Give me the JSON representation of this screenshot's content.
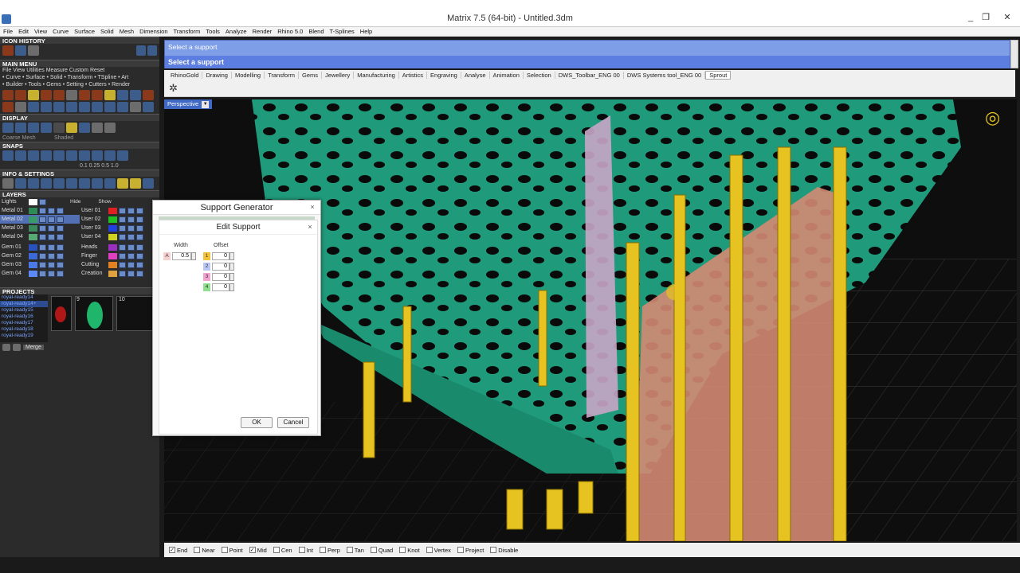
{
  "window": {
    "title": "Matrix 7.5 (64-bit) - Untitled.3dm",
    "minimize": "_",
    "maximize": "❐",
    "close": "✕"
  },
  "menu": [
    "File",
    "Edit",
    "View",
    "Curve",
    "Surface",
    "Solid",
    "Mesh",
    "Dimension",
    "Transform",
    "Tools",
    "Analyze",
    "Render",
    "Rhino 5.0",
    "Blend",
    "T-Splines",
    "Help"
  ],
  "left": {
    "icon_history": "ICON HISTORY",
    "main_menu": "MAIN MENU",
    "main_menu_row1": "File   View   Utilities   Measure   Custom            Reset",
    "main_menu_row2": "• Curve • Surface • Solid • Transform • TSpline • Art",
    "main_menu_row3": "• Builder • Tools • Gems • Setting • Cutters • Render",
    "display": "DISPLAY",
    "display_mode1": "Coarse Mesh",
    "display_mode2": "Shaded",
    "snaps": "SNAPS",
    "snap_values": "0.1   0.25   0.5   1.0",
    "info": "INFO & SETTINGS",
    "layers": "LAYERS",
    "lights": "Lights",
    "hide": "Hide",
    "show": "Show",
    "layers_left": [
      {
        "name": "Metal 01",
        "color": "#2e8b57"
      },
      {
        "name": "Metal 02",
        "color": "#3a9a6a"
      },
      {
        "name": "Metal 03",
        "color": "#3b8a5d"
      },
      {
        "name": "Metal 04",
        "color": "#57aa73"
      },
      {
        "name": "Gem 01",
        "color": "#2a52be"
      },
      {
        "name": "Gem 02",
        "color": "#3b6ad6"
      },
      {
        "name": "Gem 03",
        "color": "#4b7ae6"
      },
      {
        "name": "Gem 04",
        "color": "#5b8af6"
      }
    ],
    "layers_right": [
      {
        "name": "User 01",
        "color": "#e02020"
      },
      {
        "name": "User 02",
        "color": "#20c020"
      },
      {
        "name": "User 03",
        "color": "#2040e0"
      },
      {
        "name": "User 04",
        "color": "#d0d020"
      },
      {
        "name": "Heads",
        "color": "#9b2fc0"
      },
      {
        "name": "Finger",
        "color": "#e040c0"
      },
      {
        "name": "Cutting",
        "color": "#e08020"
      },
      {
        "name": "Creation",
        "color": "#e0a040"
      }
    ],
    "projects": "PROJECTS",
    "project_files": [
      "royal-ready14",
      "royal-ready14+",
      "royal-ready15",
      "royal-ready16",
      "royal-ready17",
      "royal-ready18",
      "royal-ready19"
    ],
    "thumb_numbers": [
      "9",
      "10"
    ],
    "merge": "Merge"
  },
  "command": {
    "line1": "Select a support",
    "line2": "Select a support"
  },
  "tabs": [
    "RhinoGold",
    "Drawing",
    "Modelling",
    "Transform",
    "Gems",
    "Jewellery",
    "Manufacturing",
    "Artistics",
    "Engraving",
    "Analyse",
    "Animation",
    "Selection",
    "DWS_Toolbar_ENG 00",
    "DWS Systems tool_ENG 00",
    "Sprout"
  ],
  "viewport": {
    "label": "Perspective",
    "dropdown": "▼"
  },
  "snapbar": [
    {
      "label": "End",
      "checked": true
    },
    {
      "label": "Near",
      "checked": false
    },
    {
      "label": "Point",
      "checked": false
    },
    {
      "label": "Mid",
      "checked": true
    },
    {
      "label": "Cen",
      "checked": false
    },
    {
      "label": "Int",
      "checked": false
    },
    {
      "label": "Perp",
      "checked": false
    },
    {
      "label": "Tan",
      "checked": false
    },
    {
      "label": "Quad",
      "checked": false
    },
    {
      "label": "Knot",
      "checked": false
    },
    {
      "label": "Vertex",
      "checked": false
    },
    {
      "label": "Project",
      "checked": false
    },
    {
      "label": "Disable",
      "checked": false
    }
  ],
  "dialog": {
    "title": "Support Generator",
    "sub_title": "Edit Support",
    "width_label": "Width",
    "offset_label": "Offset",
    "width_tag": "A",
    "width_value": "0.5",
    "offsets": [
      {
        "tag": "1",
        "color": "#f3c23a",
        "value": "0"
      },
      {
        "tag": "2",
        "color": "#b9c7f5",
        "value": "0"
      },
      {
        "tag": "3",
        "color": "#f2a3d0",
        "value": "0"
      },
      {
        "tag": "4",
        "color": "#8fe08f",
        "value": "0"
      }
    ],
    "ok": "OK",
    "cancel": "Cancel",
    "close": "×"
  },
  "colors": {
    "accent": "#5c7ee0",
    "mesh": "#1f9a7a",
    "support": "#e7c321",
    "wall": "#d38a73"
  }
}
